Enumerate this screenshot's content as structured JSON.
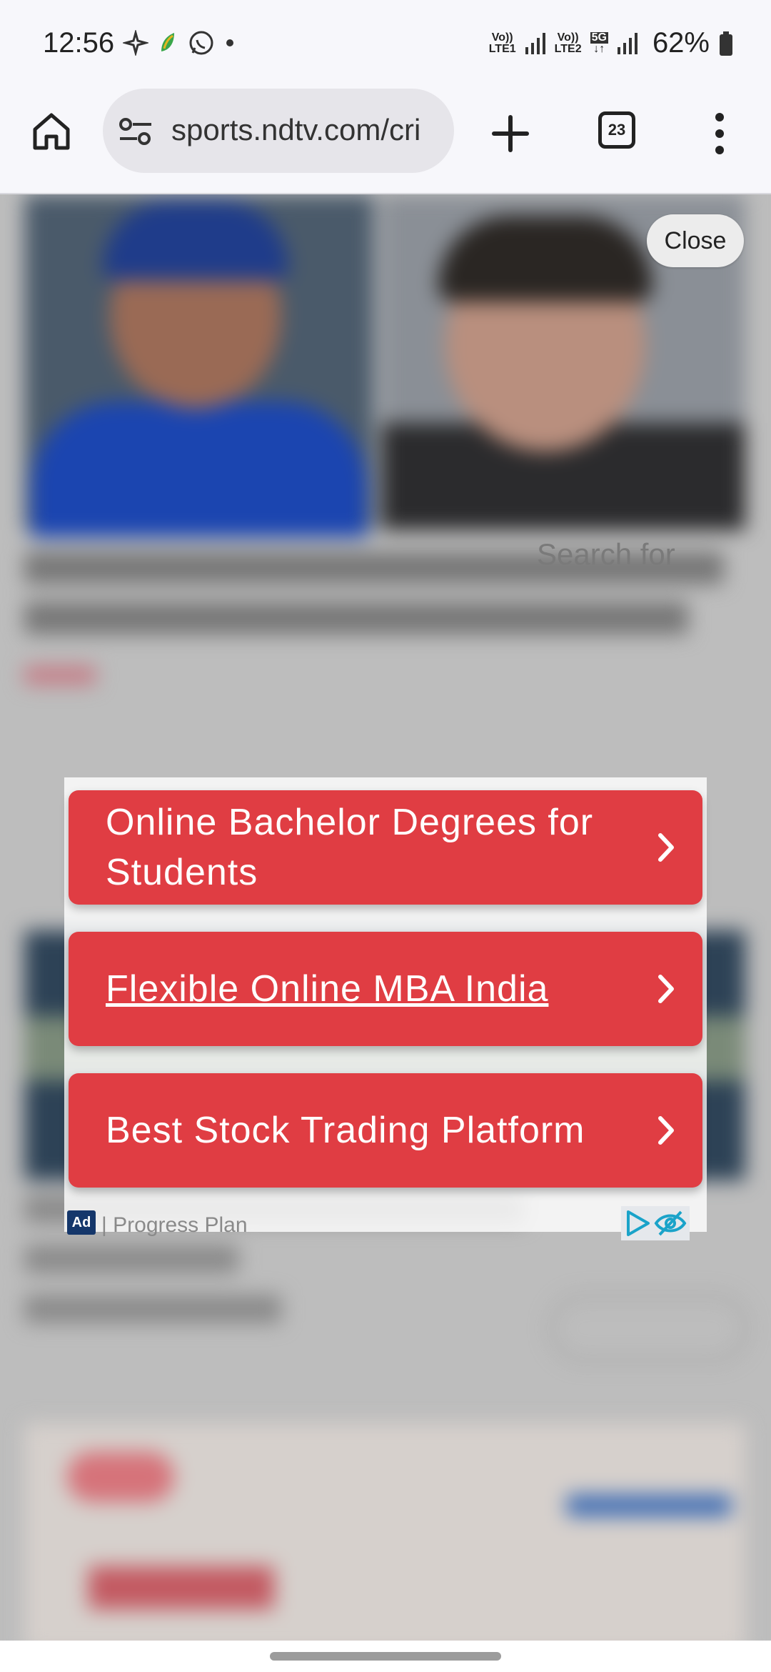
{
  "status_bar": {
    "time": "12:56",
    "network1_top": "Vo))",
    "network1_bottom": "LTE1",
    "network2_top": "Vo))",
    "network2_bottom": "LTE2",
    "network_type": "5G",
    "battery": "62%"
  },
  "toolbar": {
    "url": "sports.ndtv.com/cri",
    "tab_count": "23"
  },
  "page": {
    "close_label": "Close",
    "search_hint": "Search for"
  },
  "ad": {
    "buttons": [
      {
        "label": "Online Bachelor Degrees for Students"
      },
      {
        "label": "Flexible Online MBA India"
      },
      {
        "label": "Best Stock Trading Platform"
      }
    ],
    "badge": "Ad",
    "source": "| Progress Plan"
  },
  "colors": {
    "ad_button": "#e03d43",
    "ad_badge": "#15376b",
    "adchoices": "#1aa3c9"
  }
}
